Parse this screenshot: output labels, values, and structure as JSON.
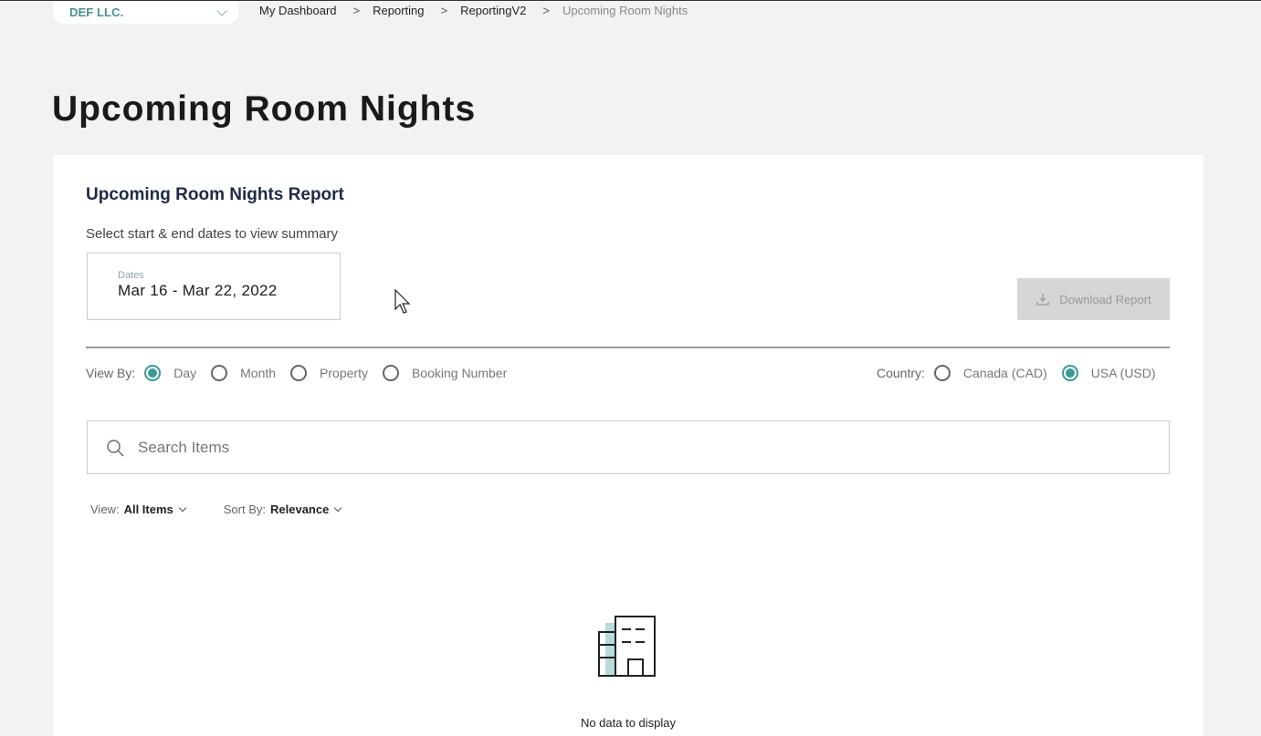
{
  "header": {
    "company": "DEF LLC.",
    "breadcrumb": [
      "My Dashboard",
      "Reporting",
      "ReportingV2",
      "Upcoming Room Nights"
    ],
    "breadcrumb_separator": ">"
  },
  "page": {
    "title": "Upcoming Room Nights"
  },
  "report": {
    "title": "Upcoming Room Nights Report",
    "subtitle": "Select start & end dates to view summary",
    "dates_label": "Dates",
    "dates_value": "Mar 16 - Mar 22, 2022",
    "download_label": "Download Report"
  },
  "view_by": {
    "label": "View By:",
    "options": [
      "Day",
      "Month",
      "Property",
      "Booking Number"
    ],
    "selected": "Day"
  },
  "country": {
    "label": "Country:",
    "options": [
      "Canada (CAD)",
      "USA (USD)"
    ],
    "selected": "USA (USD)"
  },
  "search": {
    "placeholder": "Search Items",
    "value": ""
  },
  "filters": {
    "view_label": "View:",
    "view_value": "All Items",
    "sort_label": "Sort By:",
    "sort_value": "Relevance"
  },
  "empty_state": {
    "icon": "building-icon",
    "message": "No data to display"
  },
  "colors": {
    "accent": "#3a9a96",
    "company_text": "#4a8f93",
    "icon_fill": "#b7dcd9",
    "button_disabled_bg": "#d6d6d6"
  }
}
